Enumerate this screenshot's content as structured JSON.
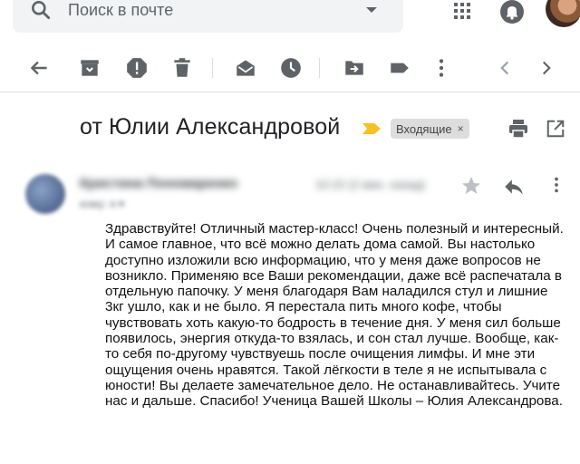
{
  "search": {
    "placeholder": "Поиск в почте"
  },
  "header": {
    "icons": [
      "search-icon",
      "caret-down-icon",
      "apps-icon",
      "bell-icon",
      "avatar"
    ]
  },
  "toolbar": {
    "icons": [
      "back-arrow-icon",
      "archive-icon",
      "report-spam-icon",
      "delete-icon",
      "mark-unread-icon",
      "snooze-icon",
      "move-to-icon",
      "label-icon",
      "more-vert-icon",
      "prev-icon",
      "next-icon"
    ]
  },
  "email": {
    "subject": "от Юлии Александровой",
    "label": "Входящие",
    "label_close": "×",
    "sender_name": "Кристина Пономаренко",
    "sender_sub": "кому: я ▾",
    "date": "10:15 (2 мин. назад)",
    "body": "Здравствуйте! Отличный мастер-класс! Очень полезный и интересный. И самое главное, что всё можно делать дома самой. Вы настолько доступно изложили всю информацию, что у меня даже вопросов не возникло. Применяю все Ваши рекомендации, даже всё распечатала в отдельную папочку. У меня благодаря Вам наладился стул и лишние 3кг ушло, как и не было. Я перестала пить много кофе, чтобы чувствовать хоть какую-то бодрость в течение дня. У меня сил больше появилось, энергия откуда-то взялась, и сон стал лучше. Вообще, как-то себя по-другому чувствуешь после очищения лимфы. И мне эти ощущения очень нравятся. Такой лёгкости в теле я не испытывала с юности! Вы делаете замечательное дело. Не останавливайтесь. Учите нас и дальше. Спасибо! Ученица Вашей Школы – Юлия Александрова."
  },
  "colors": {
    "icon": "#5f6368",
    "importance": "#f6c026",
    "chip_bg": "#dddddd"
  }
}
